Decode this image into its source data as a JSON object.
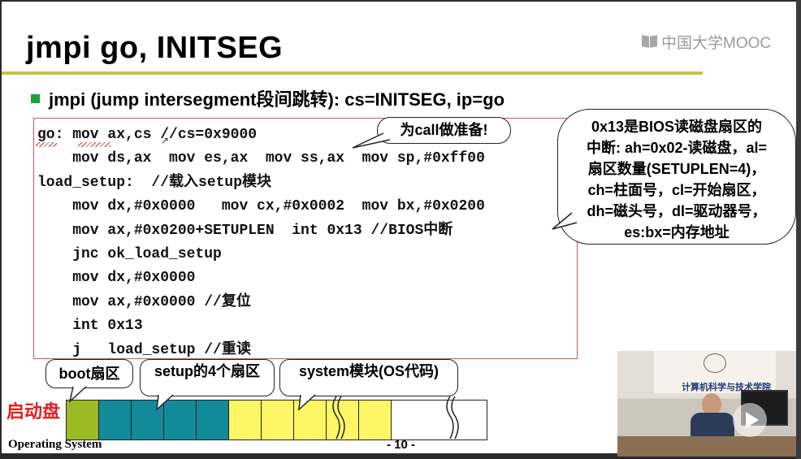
{
  "slide": {
    "title": "jmpi go, INITSEG",
    "brand": "中国大学MOOC",
    "bullet": "jmpi (jump intersegment段间跳转): cs=INITSEG, ip=go",
    "code_lines": [
      "go: mov ax,cs //cs=0x9000",
      "    mov ds,ax  mov es,ax  mov ss,ax  mov sp,#0xff00",
      "load_setup:  //载入setup模块",
      "    mov dx,#0x0000   mov cx,#0x0002  mov bx,#0x0200",
      "    mov ax,#0x0200+SETUPLEN  int 0x13 //BIOS中断",
      "    jnc ok_load_setup",
      "    mov dx,#0x0000",
      "    mov ax,#0x0000 //复位",
      "    int 0x13",
      "    j   load_setup //重读"
    ],
    "callout_prepare": "为call做准备!",
    "callout_bios": [
      "0x13是BIOS读磁盘扇区的",
      "中断: ah=0x02-读磁盘，al=",
      "扇区数量(SETUPLEN=4)，",
      "ch=柱面号，cl=开始扇区，",
      "dh=磁头号，dl=驱动器号，",
      "es:bx=内存地址"
    ],
    "disk": {
      "label": "启动盘",
      "boot_label": "boot扇区",
      "setup_label": "setup的4个扇区",
      "system_label": "system模块(OS代码)"
    },
    "footer": {
      "left": "Operating System",
      "page": "- 10 -"
    }
  },
  "video": {
    "banner_text": "计算机科学与技术学院",
    "play_icon": "play-icon"
  },
  "colors": {
    "title_rule": "#c8c24a",
    "bullet": "#1aa33a",
    "code_border": "#d9534f",
    "boot": "#9bbb25",
    "setup": "#138a9a",
    "system": "#fdf766",
    "disk_label": "#e02020"
  }
}
